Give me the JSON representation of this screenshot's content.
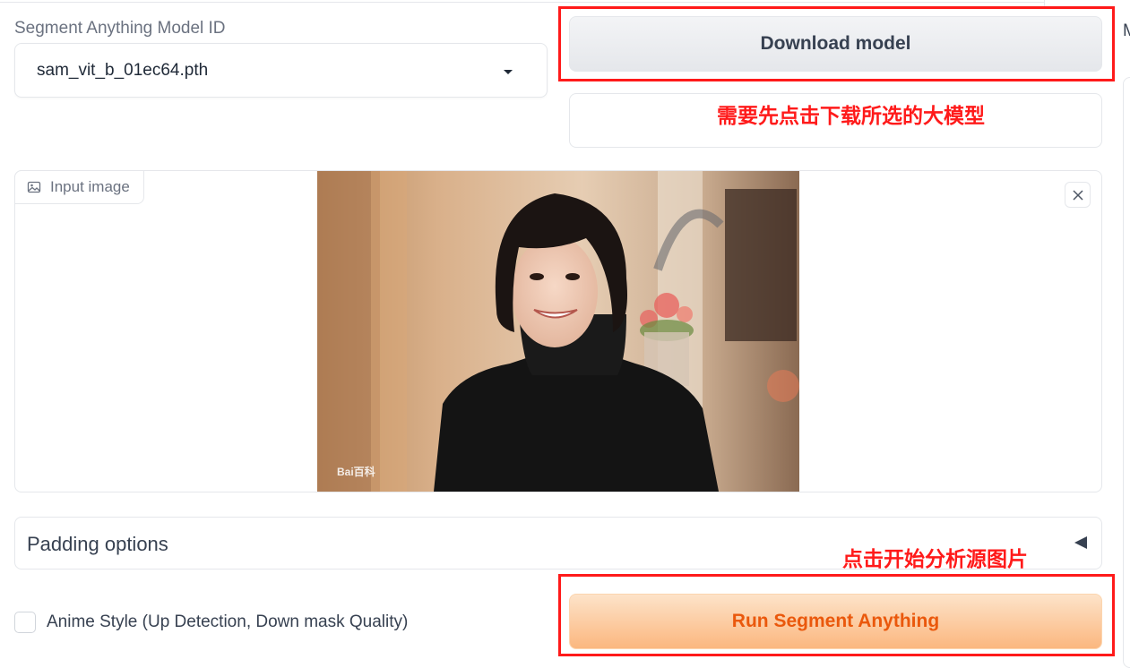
{
  "model_select": {
    "label": "Segment Anything Model ID",
    "value": "sam_vit_b_01ec64.pth"
  },
  "download_button": {
    "label": "Download model"
  },
  "annotations": {
    "download_note": "需要先点击下载所选的大模型",
    "run_note": "点击开始分析源图片",
    "frame_color": "#ff1a1a"
  },
  "right_panel": {
    "partial_label": "M"
  },
  "input_image": {
    "label": "Input image",
    "watermark": "Bai百科"
  },
  "padding_options": {
    "label": "Padding options"
  },
  "anime_style": {
    "label": "Anime Style (Up Detection, Down mask Quality)",
    "checked": false
  },
  "run_button": {
    "label": "Run Segment Anything",
    "accent": "#ea580c"
  }
}
